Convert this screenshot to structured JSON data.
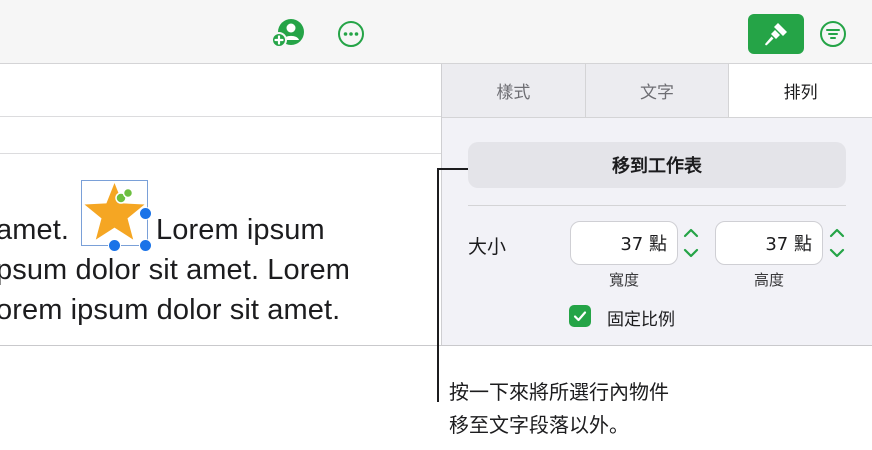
{
  "toolbar": {
    "collaborate_icon": "add-person-icon",
    "more_icon": "ellipsis-icon",
    "format_icon": "paintbrush-icon",
    "organize_icon": "filter-lines-icon",
    "accent_color": "#25a447"
  },
  "document": {
    "line1_before": "amet.",
    "line1_after": "Lorem ipsum",
    "line2": "psum dolor sit amet. Lorem",
    "line3": "orem ipsum dolor sit amet.",
    "inline_object": "star-icon",
    "selection_color": "#1a73e8"
  },
  "inspector": {
    "tabs": [
      {
        "label": "樣式",
        "active": false
      },
      {
        "label": "文字",
        "active": false
      },
      {
        "label": "排列",
        "active": true
      }
    ],
    "move_button_label": "移到工作表",
    "size_label": "大小",
    "width_value": "37 點",
    "height_value": "37 點",
    "width_caption": "寬度",
    "height_caption": "高度",
    "constrain_label": "固定比例",
    "constrain_checked": true
  },
  "callout": {
    "line1": "按一下來將所選行內物件",
    "line2": "移至文字段落以外。"
  }
}
